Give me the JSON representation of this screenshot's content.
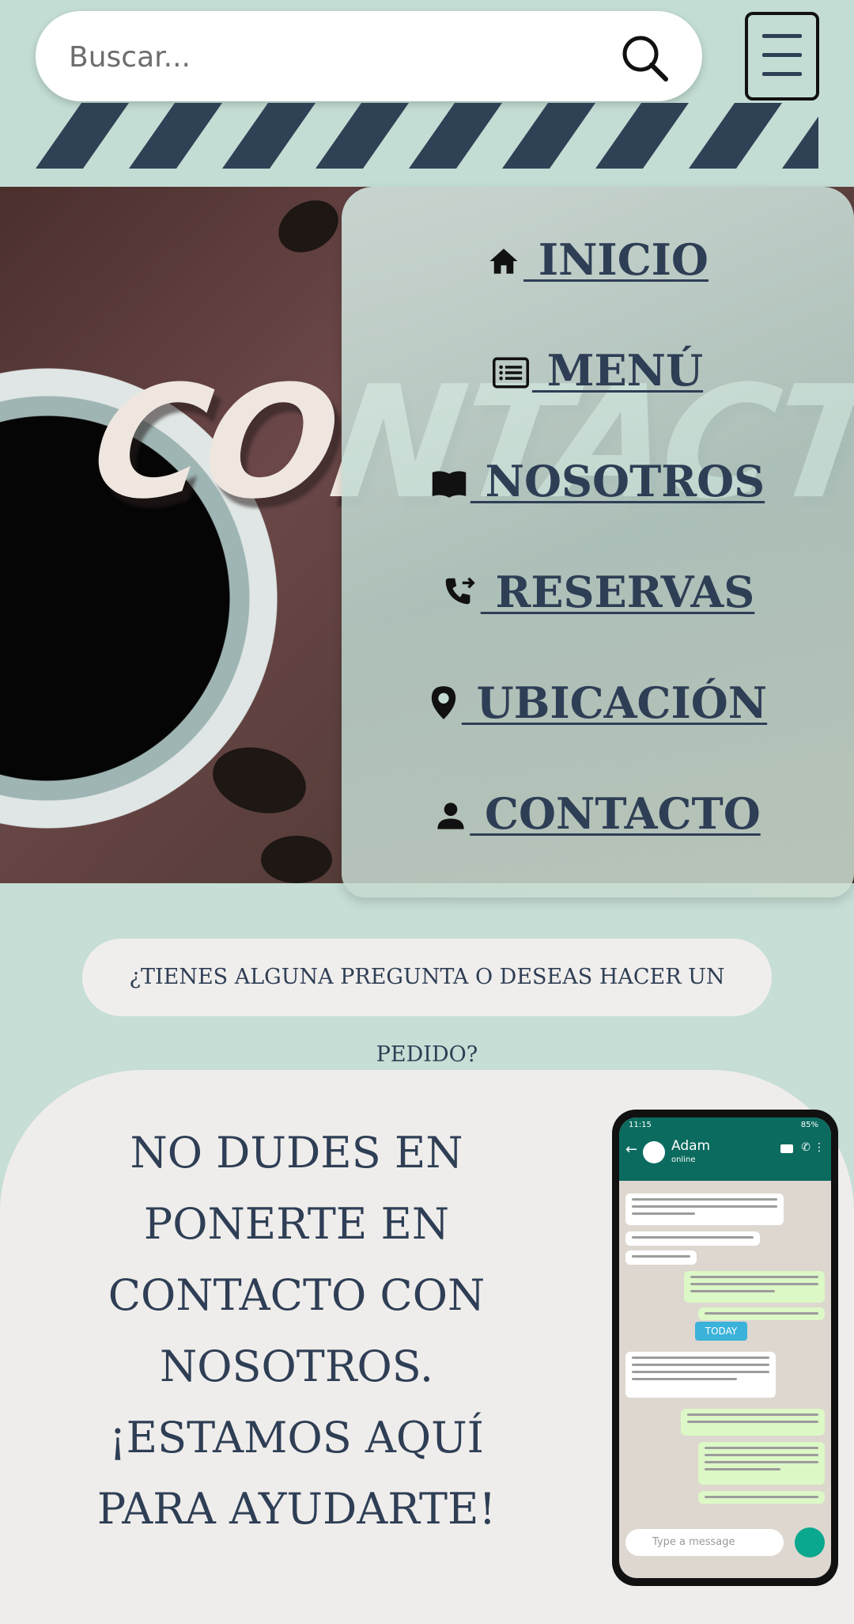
{
  "search": {
    "placeholder": "Buscar..."
  },
  "hero": {
    "title": "CONTACTO"
  },
  "nav": {
    "items": [
      {
        "label": " INICIO",
        "icon": "home-icon"
      },
      {
        "label": " MENÚ",
        "icon": "list-icon"
      },
      {
        "label": " NOSOTROS",
        "icon": "book-icon"
      },
      {
        "label": " RESERVAS",
        "icon": "phone-forward-icon"
      },
      {
        "label": " UBICACIÓN",
        "icon": "location-pin-icon"
      },
      {
        "label": " CONTACTO",
        "icon": "user-icon"
      }
    ]
  },
  "question": "¿TIENES ALGUNA PREGUNTA O DESEAS HACER UN PEDIDO?",
  "card": {
    "line1": "NO DUDES EN",
    "line2": "PONERTE EN",
    "line3": "CONTACTO CON",
    "line4": "NOSOTROS.",
    "line5": "¡ESTAMOS AQUÍ",
    "line6": "PARA AYUDARTE!"
  },
  "phone_mockup": {
    "time": "11:15",
    "battery": "85%",
    "contact_name": "Adam",
    "contact_status": "online",
    "today_label": "TODAY",
    "input_placeholder": "Type a message"
  },
  "colors": {
    "background": "#c6ded5",
    "navy": "#2e3e55",
    "card": "#efedeb"
  }
}
